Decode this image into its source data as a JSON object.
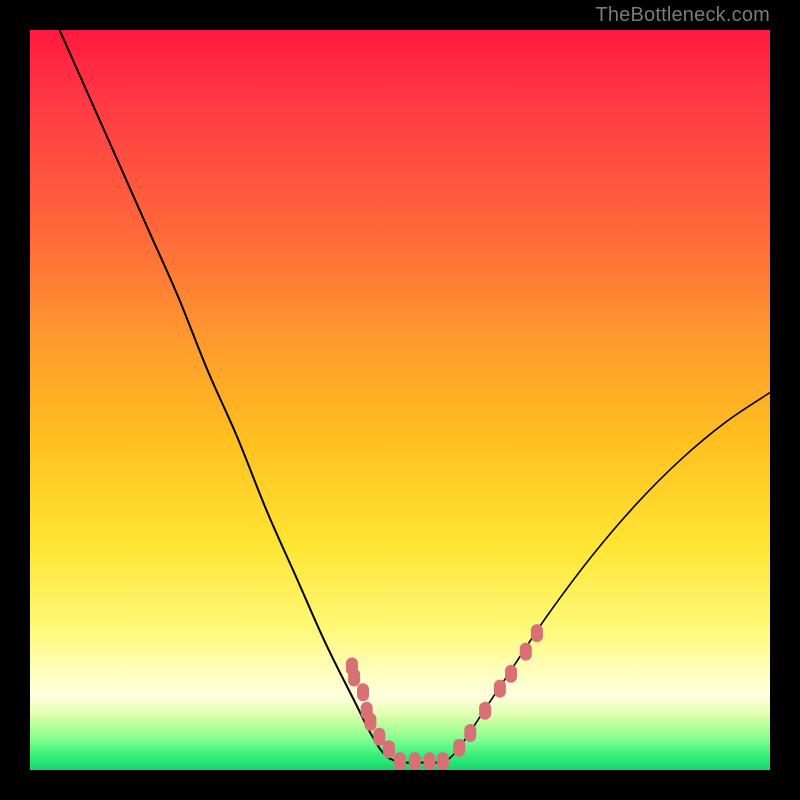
{
  "watermark": {
    "text": "TheBottleneck.com"
  },
  "chart_data": {
    "type": "line",
    "title": "",
    "xlabel": "",
    "ylabel": "",
    "xlim": [
      0,
      100
    ],
    "ylim": [
      0,
      100
    ],
    "grid": false,
    "legend": false,
    "series": [
      {
        "name": "bottleneck-curve-left",
        "x": [
          4,
          8,
          12,
          16,
          20,
          24,
          28,
          32,
          36,
          40,
          44,
          46,
          48,
          50
        ],
        "y": [
          100,
          91,
          82,
          73,
          64,
          54,
          45,
          35,
          26,
          17,
          9,
          5,
          2,
          1
        ]
      },
      {
        "name": "bottleneck-flat-min",
        "x": [
          50,
          56
        ],
        "y": [
          1,
          1
        ]
      },
      {
        "name": "bottleneck-curve-right",
        "x": [
          56,
          58,
          62,
          66,
          70,
          76,
          82,
          88,
          94,
          100
        ],
        "y": [
          1,
          3,
          9,
          15,
          21,
          29,
          36,
          42,
          47,
          51
        ]
      }
    ],
    "markers": [
      {
        "name": "datapoints-left-branch",
        "shape": "rounded-rect",
        "color": "#d87075",
        "points": [
          {
            "x": 43.5,
            "y": 14.0
          },
          {
            "x": 43.8,
            "y": 12.5
          },
          {
            "x": 45.0,
            "y": 10.5
          },
          {
            "x": 45.5,
            "y": 8.0
          },
          {
            "x": 46.0,
            "y": 6.5
          },
          {
            "x": 47.2,
            "y": 4.5
          },
          {
            "x": 48.5,
            "y": 2.8
          }
        ]
      },
      {
        "name": "datapoints-flat",
        "shape": "rounded-rect",
        "color": "#d87075",
        "points": [
          {
            "x": 50.0,
            "y": 1.2
          },
          {
            "x": 52.0,
            "y": 1.2
          },
          {
            "x": 54.0,
            "y": 1.2
          },
          {
            "x": 55.8,
            "y": 1.2
          }
        ]
      },
      {
        "name": "datapoints-right-branch",
        "shape": "rounded-rect",
        "color": "#d87075",
        "points": [
          {
            "x": 58.0,
            "y": 3.0
          },
          {
            "x": 59.5,
            "y": 5.0
          },
          {
            "x": 61.5,
            "y": 8.0
          },
          {
            "x": 63.5,
            "y": 11.0
          },
          {
            "x": 65.0,
            "y": 13.0
          },
          {
            "x": 67.0,
            "y": 16.0
          },
          {
            "x": 68.5,
            "y": 18.5
          }
        ]
      }
    ],
    "gradient_stops": [
      {
        "pos": 0.0,
        "color": "#ff1a3f"
      },
      {
        "pos": 0.5,
        "color": "#ffd233"
      },
      {
        "pos": 0.9,
        "color": "#ffffe0"
      },
      {
        "pos": 1.0,
        "color": "#18d46a"
      }
    ]
  }
}
